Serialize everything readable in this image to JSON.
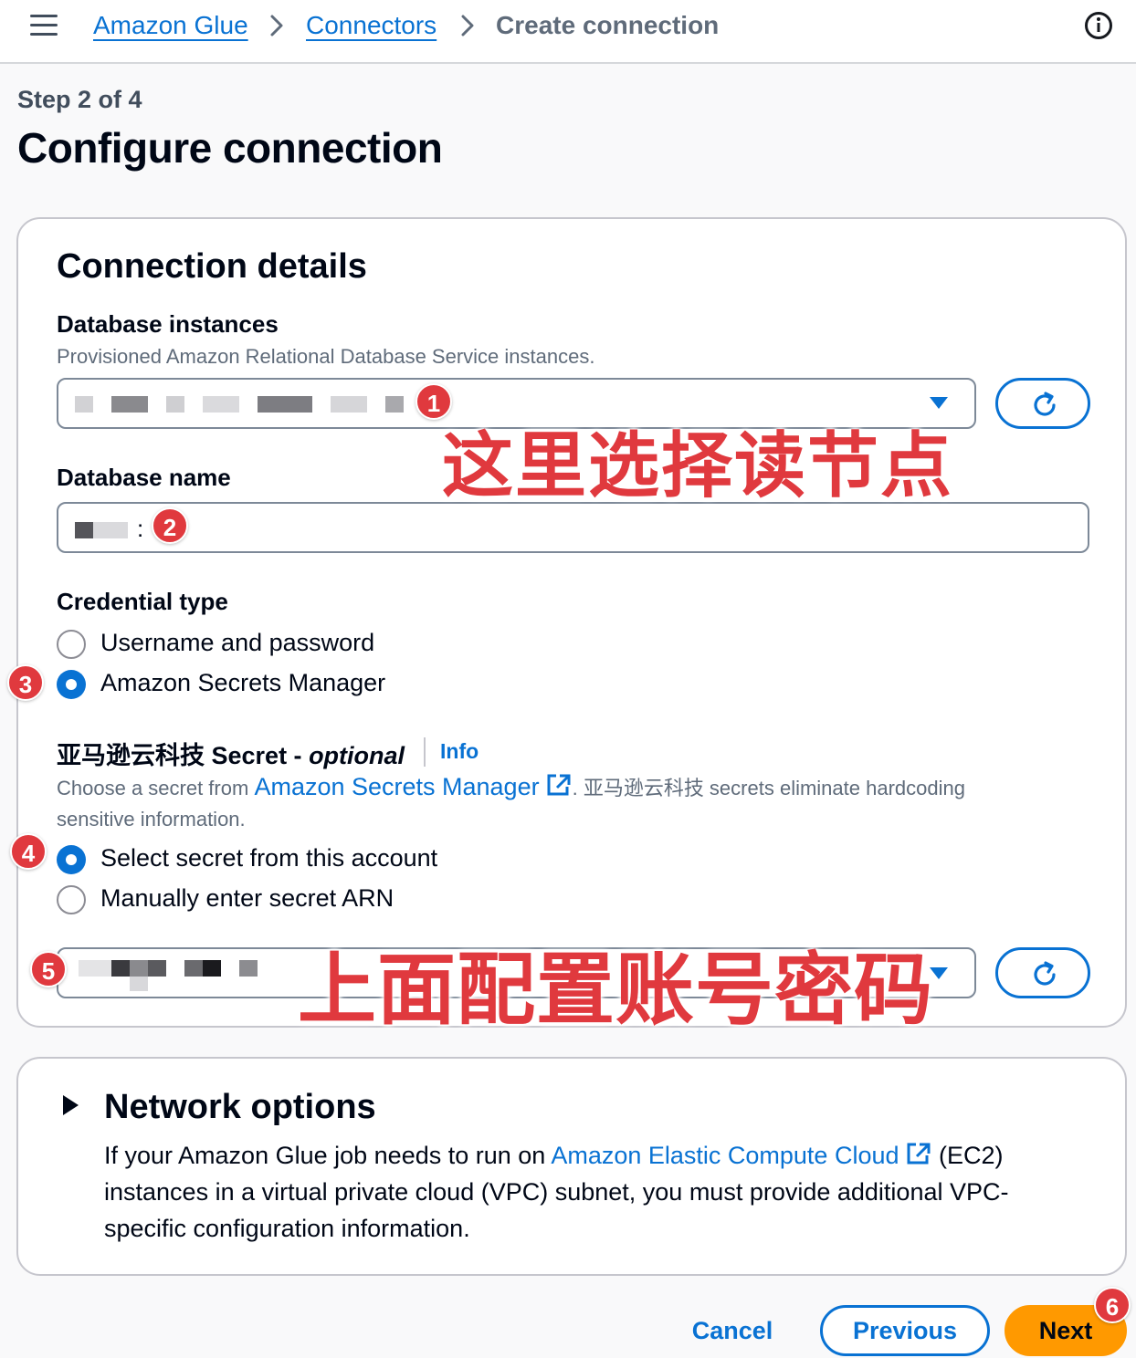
{
  "breadcrumb": {
    "items": [
      "Amazon Glue",
      "Connectors"
    ],
    "current": "Create connection"
  },
  "page": {
    "step": "Step 2 of 4",
    "title": "Configure connection"
  },
  "connection_details": {
    "title": "Connection details",
    "db_instances": {
      "label": "Database instances",
      "description": "Provisioned Amazon Relational Database Service instances."
    },
    "db_name": {
      "label": "Database name",
      "value_suffix": ":"
    },
    "credential_type": {
      "label": "Credential type",
      "options": [
        "Username and password",
        "Amazon Secrets Manager"
      ],
      "selected": "Amazon Secrets Manager"
    },
    "secret": {
      "label_main": "亚马逊云科技 Secret - ",
      "label_optional": "optional",
      "info_link": "Info",
      "desc_prefix": "Choose a secret from ",
      "desc_link": "Amazon Secrets Manager",
      "desc_suffix": ". 亚马逊云科技 secrets eliminate hardcoding",
      "desc_line2": "sensitive information.",
      "options": [
        "Select secret from this account",
        "Manually enter secret ARN"
      ],
      "selected": "Select secret from this account"
    }
  },
  "network_options": {
    "title": "Network options",
    "text_1": "If your Amazon Glue job needs to run on ",
    "link": "Amazon Elastic Compute Cloud",
    "text_2": " (EC2)",
    "line_2": "instances in a virtual private cloud (VPC) subnet, you must provide additional VPC-",
    "line_3": "specific configuration information."
  },
  "footer": {
    "cancel": "Cancel",
    "previous": "Previous",
    "next": "Next"
  },
  "annotations": {
    "badges": [
      "1",
      "2",
      "3",
      "4",
      "5",
      "6"
    ],
    "note_top": "这里选择读节点",
    "note_bottom": "上面配置账号密码"
  },
  "colors": {
    "accent": "#0972d3",
    "primary_button": "#ff9900",
    "annotation_red": "#e0393e"
  }
}
